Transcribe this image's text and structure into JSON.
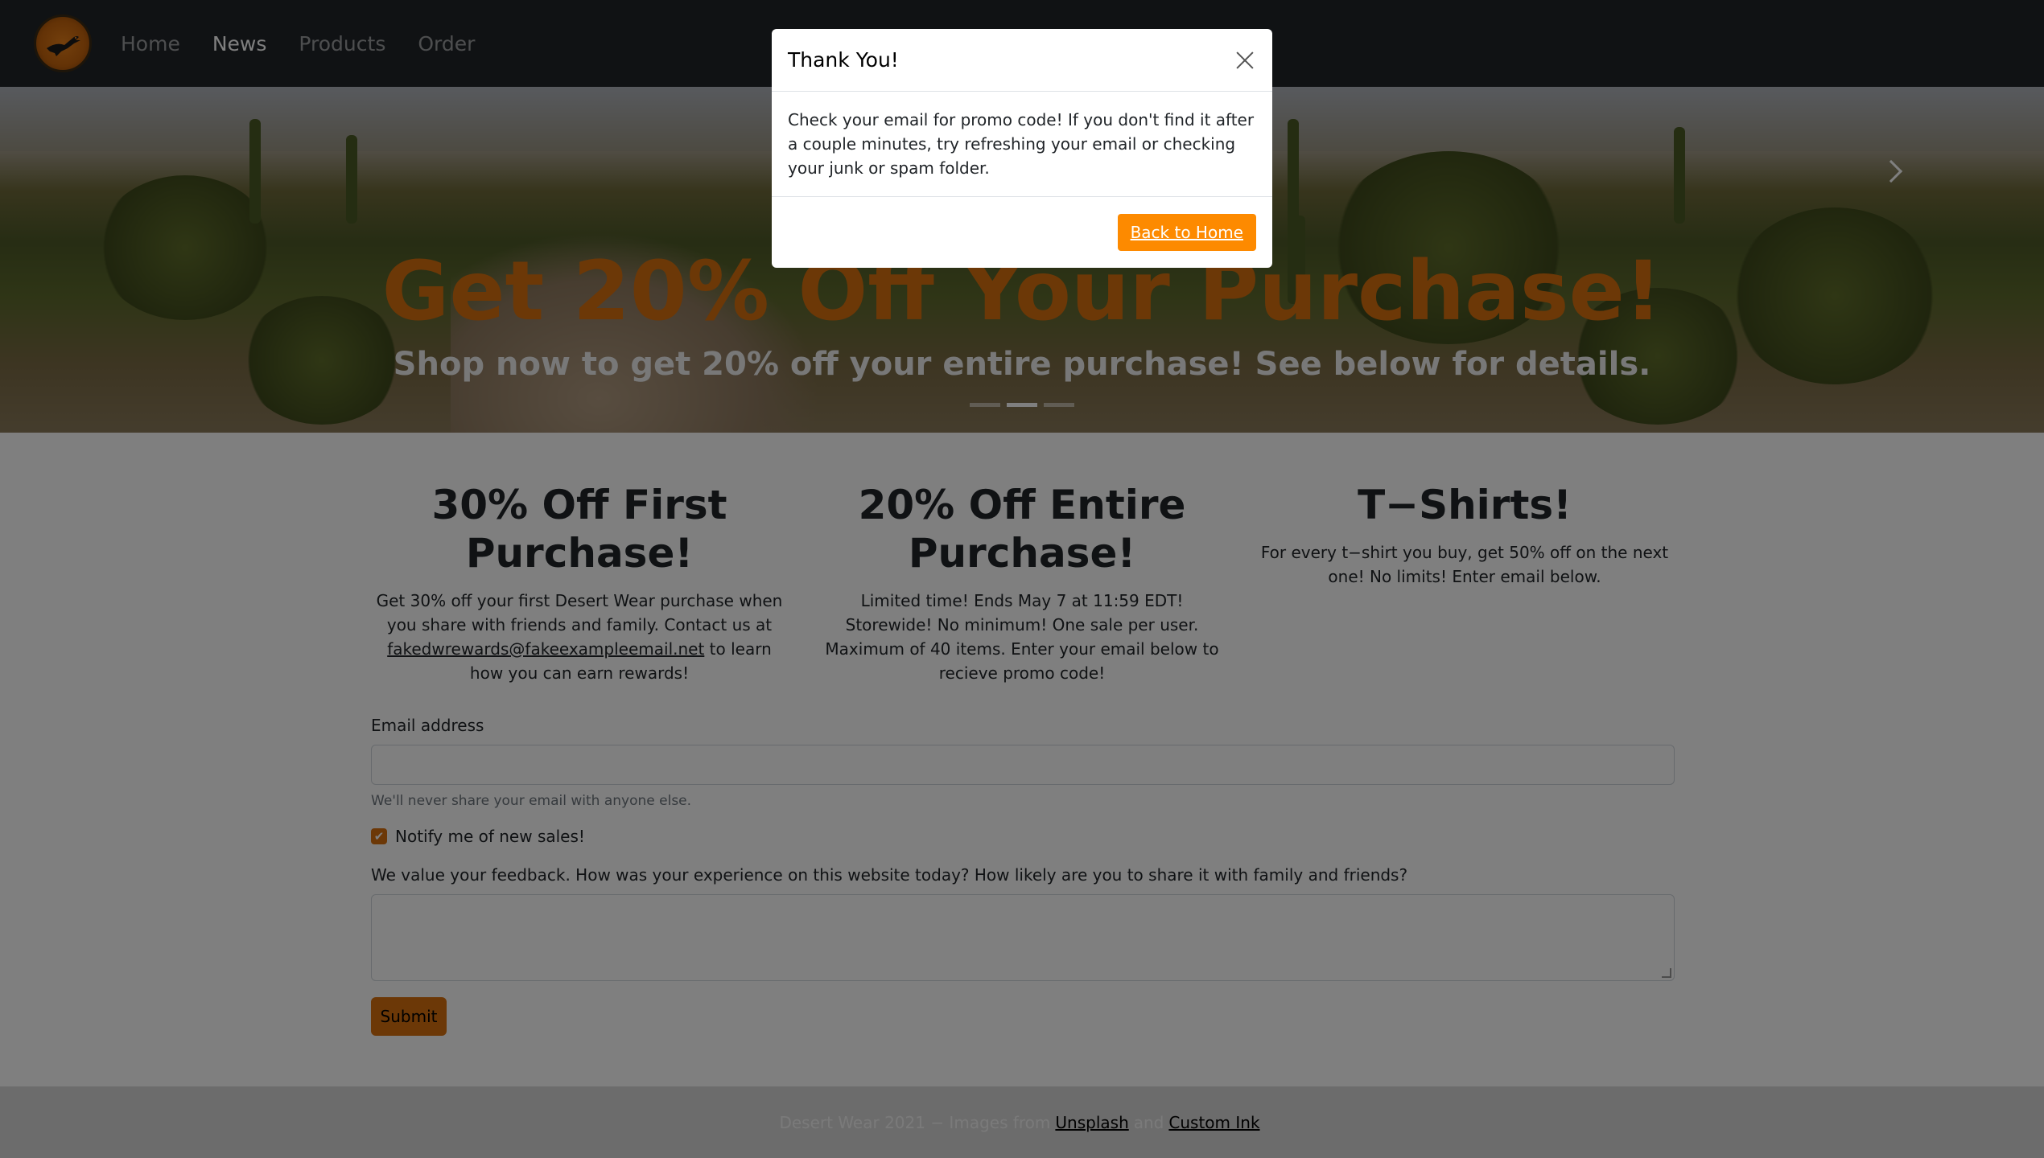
{
  "navbar": {
    "logo": "desert-wear-logo",
    "links": [
      {
        "label": "Home",
        "active": false
      },
      {
        "label": "News",
        "active": true
      },
      {
        "label": "Products",
        "active": false
      },
      {
        "label": "Order",
        "active": false
      }
    ]
  },
  "hero": {
    "title": "Get 20% Off Your Purchase!",
    "subtitle": "Shop now to get 20% off your entire purchase! See below for details.",
    "slides": 3,
    "active_slide": 2
  },
  "offers": [
    {
      "title": "30% Off First Purchase!",
      "text_before": "Get 30% off your first Desert Wear purchase when you share with friends and family. Contact us at ",
      "link": "fakedwrewards@fakeexampleemail.net",
      "text_after": " to learn how you can earn rewards!"
    },
    {
      "title": "20% Off Entire Purchase!",
      "text": "Limited time! Ends May 7 at 11:59 EDT! Storewide! No minimum! One sale per user. Maximum of 40 items. Enter your email below to recieve promo code!"
    },
    {
      "title": "T−Shirts!",
      "text": "For every t−shirt you buy, get 50% off on the next one! No limits! Enter email below."
    }
  ],
  "form": {
    "email_label": "Email address",
    "email_value": "",
    "email_help": "We'll never share your email with anyone else.",
    "notify_label": "Notify me of new sales!",
    "notify_checked": true,
    "feedback_label": "We value your feedback. How was your experience on this website today? How likely are you to share it with family and friends?",
    "feedback_value": "",
    "submit_label": "Submit"
  },
  "footer": {
    "text": "Desert Wear 2021 − Images from",
    "link1": "Unsplash",
    "and": "and",
    "link2": "Custom Ink"
  },
  "modal": {
    "title": "Thank You!",
    "body": "Check your email for promo code! If you don't find it after a couple minutes, try refreshing your email or checking your junk or spam folder.",
    "button": "Back to Home"
  },
  "colors": {
    "accent": "#d9700f",
    "navbar": "#212529",
    "modal_button": "#fd8a00"
  }
}
